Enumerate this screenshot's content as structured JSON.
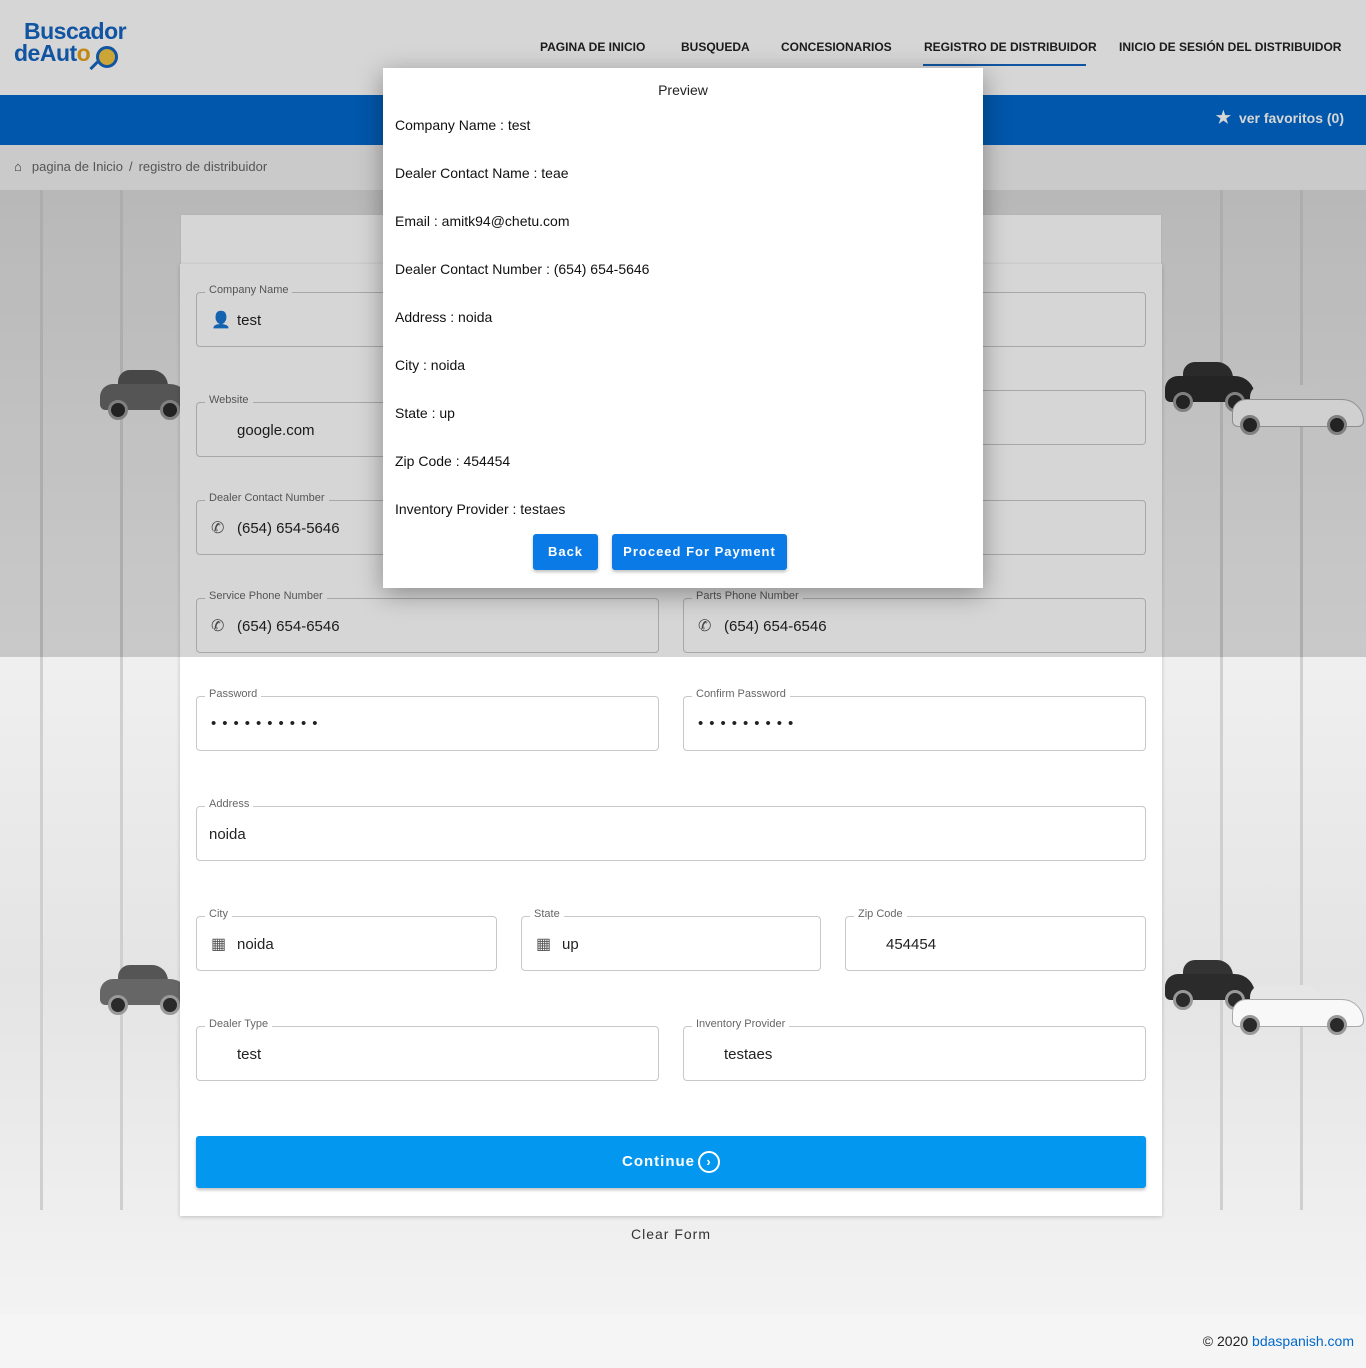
{
  "brand": {
    "line1": "Buscador",
    "line2a": "deAut",
    "line2b": "o"
  },
  "nav": {
    "items": [
      "PAGINA DE INICIO",
      "BUSQUEDA",
      "CONCESIONARIOS",
      "REGISTRO DE DISTRIBUIDOR",
      "INICIO DE SESIÓN DEL DISTRIBUIDOR"
    ],
    "active_index": 3
  },
  "favorites": {
    "label": "ver favoritos (0)"
  },
  "breadcrumb": {
    "home": "pagina de Inicio",
    "separator": "/",
    "current": "registro de distribuidor"
  },
  "form": {
    "company_name": {
      "label": "Company Name",
      "value": "test"
    },
    "website": {
      "label": "Website",
      "value": "google.com"
    },
    "dealer_contact_number": {
      "label": "Dealer Contact Number",
      "value": "(654) 654-5646"
    },
    "service_phone": {
      "label": "Service Phone Number",
      "value": "(654) 654-6546"
    },
    "parts_phone": {
      "label": "Parts Phone Number",
      "value": "(654) 654-6546"
    },
    "password": {
      "label": "Password",
      "value": "••••••••••"
    },
    "confirm_password": {
      "label": "Confirm Password",
      "value": "•••••••••"
    },
    "address": {
      "label": "Address",
      "value": "noida"
    },
    "city": {
      "label": "City",
      "value": "noida"
    },
    "state": {
      "label": "State",
      "value": "up"
    },
    "zip": {
      "label": "Zip Code",
      "value": "454454"
    },
    "dealer_type": {
      "label": "Dealer Type",
      "value": "test"
    },
    "inventory_provider": {
      "label": "Inventory Provider",
      "value": "testaes"
    },
    "continue_label": "Continue",
    "clear_label": "Clear Form"
  },
  "preview": {
    "title": "Preview",
    "rows": [
      "Company Name : test",
      "Dealer Contact Name : teae",
      "Email : amitk94@chetu.com",
      "Dealer Contact Number : (654) 654-5646",
      "Address : noida",
      "City : noida",
      "State : up",
      "Zip Code : 454454",
      "Inventory Provider : testaes"
    ],
    "back_label": "Back",
    "proceed_label": "Proceed For Payment"
  },
  "footer": {
    "copyright": "© 2020",
    "site": "bdaspanish.com"
  },
  "colors": {
    "primary": "#0068cc",
    "accent": "#0397f0",
    "button": "#0a7ae6"
  }
}
